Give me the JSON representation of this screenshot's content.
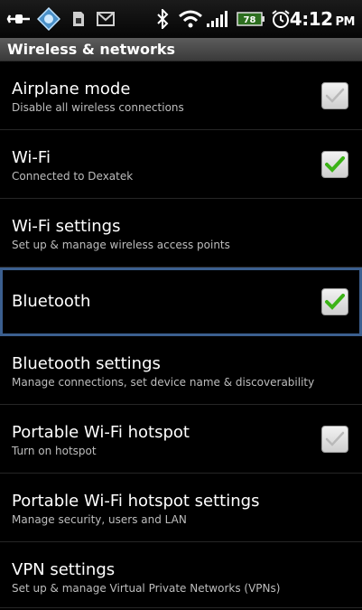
{
  "status_bar": {
    "time": "4:12",
    "ampm": "PM",
    "battery_level": "78",
    "icons": [
      "usb-connection-icon",
      "sync-icon",
      "sd-card-icon",
      "mail-icon",
      "bluetooth-icon",
      "wifi-icon",
      "signal-icon",
      "battery-icon",
      "alarm-icon"
    ]
  },
  "header": {
    "title": "Wireless & networks"
  },
  "settings": [
    {
      "title": "Airplane mode",
      "summary": "Disable all wireless connections",
      "checkbox": true,
      "checked": false
    },
    {
      "title": "Wi-Fi",
      "summary": "Connected to Dexatek",
      "checkbox": true,
      "checked": true
    },
    {
      "title": "Wi-Fi settings",
      "summary": "Set up & manage wireless access points",
      "checkbox": false
    },
    {
      "title": "Bluetooth",
      "summary": "",
      "checkbox": true,
      "checked": true,
      "selected": true
    },
    {
      "title": "Bluetooth settings",
      "summary": "Manage connections, set device name & discoverability",
      "checkbox": false
    },
    {
      "title": "Portable Wi-Fi hotspot",
      "summary": "Turn on hotspot",
      "checkbox": true,
      "checked": false
    },
    {
      "title": "Portable Wi-Fi hotspot settings",
      "summary": "Manage security, users and LAN",
      "checkbox": false
    },
    {
      "title": "VPN settings",
      "summary": "Set up & manage Virtual Private Networks (VPNs)",
      "checkbox": false
    }
  ],
  "colors": {
    "check_green": "#3cb317",
    "check_gray": "#b9b9b9",
    "selection_border": "#3b5f8f"
  }
}
